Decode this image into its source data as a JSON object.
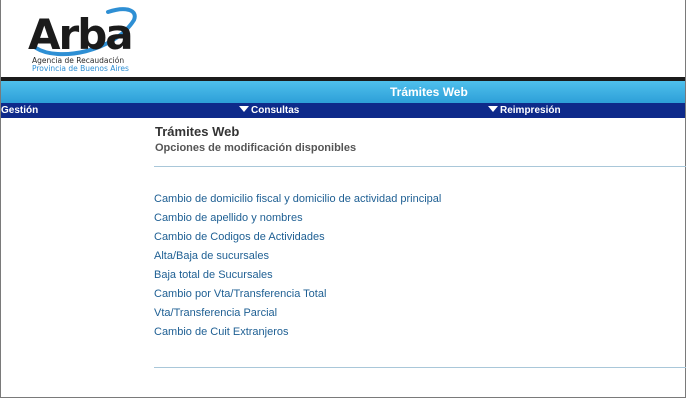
{
  "logo": {
    "name": "Arba",
    "line1": "Agencia de Recaudación",
    "line2": "Provincia de Buenos Aires"
  },
  "header": {
    "title": "Trámites Web"
  },
  "nav": {
    "items": [
      {
        "label": "Gestión",
        "has_caret": false
      },
      {
        "label": "Consultas",
        "has_caret": true
      },
      {
        "label": "Reimpresión",
        "has_caret": true
      }
    ]
  },
  "content": {
    "title": "Trámites Web",
    "subtitle": "Opciones de modificación disponibles",
    "links": [
      "Cambio de domicilio fiscal y domicilio de actividad principal",
      "Cambio de apellido y nombres",
      "Cambio de Codigos de Actividades",
      "Alta/Baja de sucursales",
      "Baja total de Sucursales",
      "Cambio por Vta/Transferencia Total",
      "Vta/Transferencia Parcial",
      "Cambio de Cuit Extranjeros"
    ]
  },
  "colors": {
    "title_bar": "#2d9fd8",
    "nav_bar": "#0e2a8a",
    "link": "#1e5f93"
  }
}
